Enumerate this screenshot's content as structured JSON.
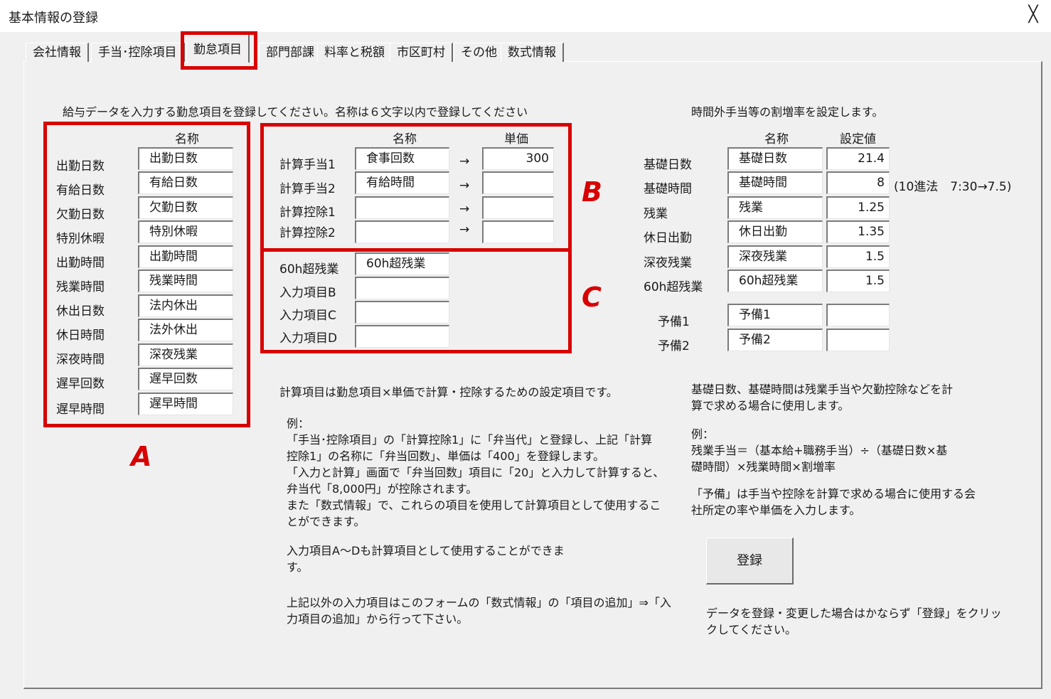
{
  "window": {
    "title": "基本情報の登録",
    "close_glyph": "╳"
  },
  "tabs": [
    {
      "label": "会社情報"
    },
    {
      "label": "手当･控除項目"
    },
    {
      "label": "勤怠項目"
    },
    {
      "label": "部門部課"
    },
    {
      "label": "料率と税額"
    },
    {
      "label": "市区町村"
    },
    {
      "label": "その他"
    },
    {
      "label": "数式情報"
    }
  ],
  "active_tab": "勤怠項目",
  "left": {
    "instruction": "給与データを入力する勤怠項目を登録してください。名称は６文字以内で登録してください",
    "header": "名称",
    "rows": [
      {
        "label": "出勤日数",
        "value": "出勤日数"
      },
      {
        "label": "有給日数",
        "value": "有給日数"
      },
      {
        "label": "欠勤日数",
        "value": "欠勤日数"
      },
      {
        "label": "特別休暇",
        "value": "特別休暇"
      },
      {
        "label": "出勤時間",
        "value": "出勤時間"
      },
      {
        "label": "残業時間",
        "value": "残業時間"
      },
      {
        "label": "休出日数",
        "value": "法内休出"
      },
      {
        "label": "休日時間",
        "value": "法外休出"
      },
      {
        "label": "深夜時間",
        "value": "深夜残業"
      },
      {
        "label": "遅早回数",
        "value": "遅早回数"
      },
      {
        "label": "遅早時間",
        "value": "遅早時間"
      }
    ],
    "marker": "A"
  },
  "calc": {
    "header_name": "名称",
    "header_price": "単価",
    "arrow": "→",
    "rows": [
      {
        "label": "計算手当1",
        "name": "食事回数",
        "price": "300"
      },
      {
        "label": "計算手当2",
        "name": "有給時間",
        "price": ""
      },
      {
        "label": "計算控除1",
        "name": "",
        "price": ""
      },
      {
        "label": "計算控除2",
        "name": "",
        "price": ""
      }
    ],
    "marker": "B"
  },
  "inputs": {
    "rows": [
      {
        "label": "60h超残業",
        "value": "60h超残業"
      },
      {
        "label": "入力項目B",
        "value": ""
      },
      {
        "label": "入力項目C",
        "value": ""
      },
      {
        "label": "入力項目D",
        "value": ""
      }
    ],
    "marker": "C"
  },
  "middle_text": {
    "p1": "計算項目は勤怠項目×単価で計算・控除するための設定項目です。",
    "p2": "例：\n「手当･控除項目」の「計算控除1」に「弁当代」と登録し、上記「計算\n控除1」の名称に「弁当回数」、単価は「400」を登録します。\n「入力と計算」画面で「弁当回数」項目に「20」と入力して計算すると、\n弁当代「8,000円」が控除されます。\nまた「数式情報」で、これらの項目を使用して計算項目として使用するこ\nとができます。",
    "p3": "入力項目A～Dも計算項目として使用することができま\nす。",
    "p4": "上記以外の入力項目はこのフォームの「数式情報」の「項目の追加」⇒「入\n力項目の追加」から行って下さい。"
  },
  "right": {
    "instruction": "時間外手当等の割増率を設定します。",
    "header_name": "名称",
    "header_value": "設定値",
    "rows": [
      {
        "label": "基礎日数",
        "name": "基礎日数",
        "value": "21.4"
      },
      {
        "label": "基礎時間",
        "name": "基礎時間",
        "value": "8"
      },
      {
        "label": "残業",
        "name": "残業",
        "value": "1.25"
      },
      {
        "label": "休日出勤",
        "name": "休日出勤",
        "value": "1.35"
      },
      {
        "label": "深夜残業",
        "name": "深夜残業",
        "value": "1.5"
      },
      {
        "label": "60h超残業",
        "name": "60h超残業",
        "value": "1.5"
      }
    ],
    "note": "(10進法　7:30→7.5)",
    "reserve": [
      {
        "label": "予備1",
        "name": "予備1",
        "value": ""
      },
      {
        "label": "予備2",
        "name": "予備2",
        "value": ""
      }
    ],
    "text1": "基礎日数、基礎時間は残業手当や欠勤控除などを計\n算で求める場合に使用します。",
    "text2": "例：\n残業手当＝（基本給+職務手当）÷（基礎日数×基\n礎時間）×残業時間×割増率",
    "text3": "「予備」は手当や控除を計算で求める場合に使用する会\n社所定の率や単価を入力します。",
    "register_label": "登録",
    "footer": "データを登録・変更した場合はかならず「登録」をクリッ\nクしてください。"
  },
  "colors": {
    "highlight": "#d80000",
    "dialog": "#f0f0f0"
  }
}
